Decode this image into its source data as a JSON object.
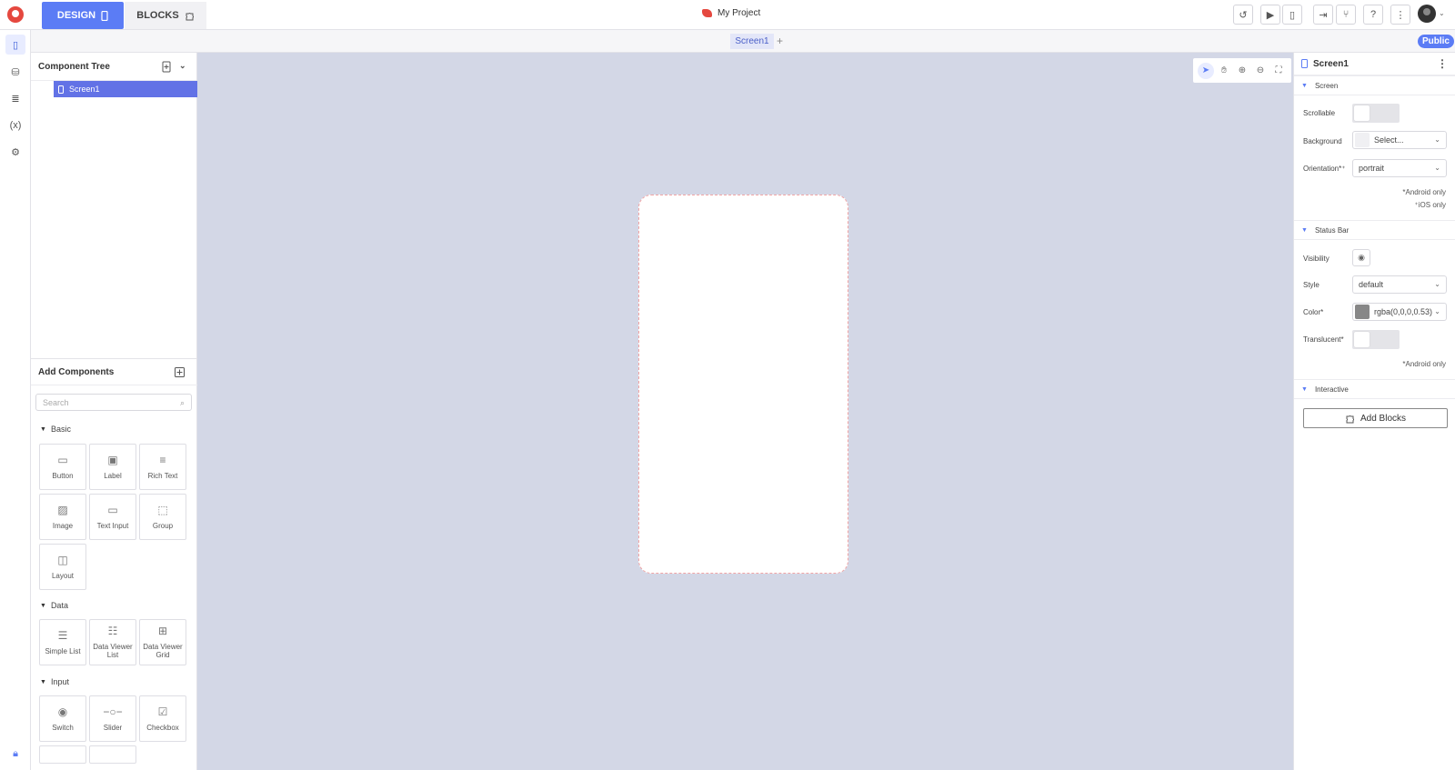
{
  "topbar": {
    "design_tab": "DESIGN",
    "blocks_tab": "BLOCKS",
    "project_name": "My Project",
    "icons": [
      "history-icon",
      "preview-icon",
      "device-preview-icon",
      "export-icon",
      "share-icon",
      "help-icon",
      "more-icon"
    ]
  },
  "screen_tabs": {
    "active": "Screen1",
    "add": "+",
    "public_badge": "Public"
  },
  "component_tree": {
    "title": "Component Tree",
    "items": [
      "Screen1"
    ]
  },
  "add_components": {
    "title": "Add Components",
    "search_placeholder": "Search",
    "sections": [
      {
        "label": "Basic",
        "items": [
          "Button",
          "Label",
          "Rich Text",
          "Image",
          "Text Input",
          "Group",
          "Layout"
        ]
      },
      {
        "label": "Data",
        "items": [
          "Simple List",
          "Data Viewer List",
          "Data Viewer Grid"
        ]
      },
      {
        "label": "Input",
        "items": [
          "Switch",
          "Slider",
          "Checkbox"
        ]
      }
    ]
  },
  "properties": {
    "title": "Screen1",
    "screen_section": "Screen",
    "scrollable_label": "Scrollable",
    "background_label": "Background",
    "background_value": "Select...",
    "orientation_label": "Orientation*⁺",
    "orientation_value": "portrait",
    "note_android": "*Android only",
    "note_ios": "⁺iOS only",
    "status_section": "Status Bar",
    "visibility_label": "Visibility",
    "style_label": "Style",
    "style_value": "default",
    "color_label": "Color*",
    "color_value": "rgba(0,0,0,0.53)",
    "translucent_label": "Translucent*",
    "note_android2": "*Android only",
    "interactive_section": "Interactive",
    "add_blocks": "Add Blocks"
  },
  "colors": {
    "accent": "#5b7cf5",
    "canvas_bg": "#d3d7e6",
    "tree_selected": "#6272e6",
    "status_color_swatch": "#878787"
  }
}
